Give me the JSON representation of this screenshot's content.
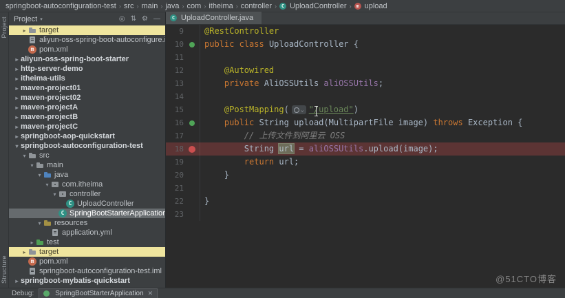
{
  "breadcrumb": {
    "separator": "›",
    "items": [
      {
        "label": "springboot-autoconfiguration-test"
      },
      {
        "label": "src"
      },
      {
        "label": "main"
      },
      {
        "label": "java"
      },
      {
        "label": "com"
      },
      {
        "label": "itheima"
      },
      {
        "label": "controller"
      },
      {
        "label": "UploadController",
        "icon": "class-icon"
      },
      {
        "label": "upload",
        "icon": "method-icon"
      }
    ]
  },
  "tool_strip": {
    "top": "Project",
    "bottom": "Structure"
  },
  "project_panel": {
    "title": "Project",
    "header_icons": [
      {
        "name": "locate-icon",
        "glyph": "◎"
      },
      {
        "name": "expand-collapse-icon",
        "glyph": "⇅"
      },
      {
        "name": "settings-gear-icon",
        "glyph": "⚙"
      },
      {
        "name": "hide-panel-icon",
        "glyph": "—"
      }
    ],
    "tree": [
      {
        "label": "target",
        "indent": 1,
        "chevron": "closed",
        "icon": "folder-icon",
        "highlight": "yellow"
      },
      {
        "label": "aliyun-oss-spring-boot-autoconfigure.iml",
        "indent": 1,
        "icon": "file-icon"
      },
      {
        "label": "pom.xml",
        "indent": 1,
        "icon": "maven-icon"
      },
      {
        "label": "aliyun-oss-spring-boot-starter",
        "indent": 0,
        "chevron": "closed",
        "bold": true
      },
      {
        "label": "http-server-demo",
        "indent": 0,
        "chevron": "closed",
        "bold": true
      },
      {
        "label": "itheima-utils",
        "indent": 0,
        "chevron": "closed",
        "bold": true
      },
      {
        "label": "maven-project01",
        "indent": 0,
        "chevron": "closed",
        "bold": true
      },
      {
        "label": "maven-project02",
        "indent": 0,
        "chevron": "closed",
        "bold": true
      },
      {
        "label": "maven-projectA",
        "indent": 0,
        "chevron": "closed",
        "bold": true
      },
      {
        "label": "maven-projectB",
        "indent": 0,
        "chevron": "closed",
        "bold": true
      },
      {
        "label": "maven-projectC",
        "indent": 0,
        "chevron": "closed",
        "bold": true
      },
      {
        "label": "springboot-aop-quickstart",
        "indent": 0,
        "chevron": "closed",
        "bold": true
      },
      {
        "label": "springboot-autoconfiguration-test",
        "indent": 0,
        "chevron": "open",
        "bold": true
      },
      {
        "label": "src",
        "indent": 1,
        "chevron": "open",
        "icon": "folder-icon"
      },
      {
        "label": "main",
        "indent": 2,
        "chevron": "open",
        "icon": "folder-icon"
      },
      {
        "label": "java",
        "indent": 3,
        "chevron": "open",
        "icon": "source-folder-icon"
      },
      {
        "label": "com.itheima",
        "indent": 4,
        "chevron": "open",
        "icon": "package-icon"
      },
      {
        "label": "controller",
        "indent": 5,
        "chevron": "open",
        "icon": "package-icon"
      },
      {
        "label": "UploadController",
        "indent": 6,
        "icon": "class-icon"
      },
      {
        "label": "SpringBootStarterApplication",
        "indent": 5,
        "icon": "class-icon",
        "selected": true
      },
      {
        "label": "resources",
        "indent": 3,
        "chevron": "open",
        "icon": "resources-folder-icon"
      },
      {
        "label": "application.yml",
        "indent": 4,
        "icon": "file-icon"
      },
      {
        "label": "test",
        "indent": 2,
        "chevron": "closed",
        "icon": "test-folder-icon"
      },
      {
        "label": "target",
        "indent": 1,
        "chevron": "closed",
        "icon": "folder-icon",
        "highlight": "yellow"
      },
      {
        "label": "pom.xml",
        "indent": 1,
        "icon": "maven-icon"
      },
      {
        "label": "springboot-autoconfiguration-test.iml",
        "indent": 1,
        "icon": "file-icon"
      },
      {
        "label": "springboot-mybatis-quickstart",
        "indent": 0,
        "chevron": "closed",
        "bold": true
      }
    ]
  },
  "editor": {
    "tab": {
      "label": "UploadController.java",
      "icon": "class-icon"
    },
    "lines": [
      {
        "num": 9,
        "segs": [
          [
            "@RestController",
            "ann"
          ]
        ]
      },
      {
        "num": 10,
        "gutter": "bean",
        "segs": [
          [
            "public ",
            "kw"
          ],
          [
            "class ",
            "kw"
          ],
          [
            "UploadController {",
            "def"
          ]
        ]
      },
      {
        "num": 11,
        "segs": []
      },
      {
        "num": 12,
        "segs": [
          [
            "    ",
            "def"
          ],
          [
            "@Autowired",
            "ann"
          ]
        ]
      },
      {
        "num": 13,
        "segs": [
          [
            "    ",
            "def"
          ],
          [
            "private ",
            "kw"
          ],
          [
            "AliOSSUtils ",
            "def"
          ],
          [
            "aliOSSUtils",
            "field"
          ],
          [
            ";",
            "def"
          ]
        ]
      },
      {
        "num": 14,
        "segs": []
      },
      {
        "num": 15,
        "segs": [
          [
            "    ",
            "def"
          ],
          [
            "@PostMapping",
            "ann"
          ],
          [
            "(",
            "def"
          ],
          [
            "",
            "inlay"
          ],
          [
            "\"/upload\"",
            "strU"
          ],
          [
            ")",
            "def"
          ]
        ]
      },
      {
        "num": 16,
        "gutter": "bean",
        "segs": [
          [
            "    ",
            "def"
          ],
          [
            "public ",
            "kw"
          ],
          [
            "String upload(MultipartFile image) ",
            "def"
          ],
          [
            "throws ",
            "kw"
          ],
          [
            "Exception {",
            "def"
          ]
        ]
      },
      {
        "num": 17,
        "segs": [
          [
            "        ",
            "def"
          ],
          [
            "// 上传文件到阿里云 OSS",
            "cmt"
          ]
        ]
      },
      {
        "num": 18,
        "gutter": "breakpoint",
        "line_style": "breakpoint",
        "segs": [
          [
            "        ",
            "def"
          ],
          [
            "String ",
            "def"
          ],
          [
            "url",
            "hl"
          ],
          [
            " = ",
            "def"
          ],
          [
            "aliOSSUtils",
            "field"
          ],
          [
            ".upload(image);",
            "def"
          ]
        ]
      },
      {
        "num": 19,
        "segs": [
          [
            "        ",
            "def"
          ],
          [
            "return ",
            "kw"
          ],
          [
            "url;",
            "def"
          ]
        ]
      },
      {
        "num": 20,
        "segs": [
          [
            "    }",
            "def"
          ]
        ]
      },
      {
        "num": 21,
        "segs": []
      },
      {
        "num": 22,
        "segs": [
          [
            "}",
            "def"
          ]
        ]
      },
      {
        "num": 23,
        "segs": []
      }
    ]
  },
  "debug_bar": {
    "label": "Debug:",
    "tab": {
      "icon": "spring-boot-icon",
      "label": "SpringBootStarterApplication",
      "close": "✕"
    }
  },
  "watermark": "@51CTO博客",
  "colors": {
    "panel_bg": "#3c3f41",
    "editor_bg": "#2b2b2b",
    "annotation": "#bbb529",
    "keyword": "#cc7832",
    "string": "#6a8759",
    "comment": "#808080",
    "field": "#9876aa",
    "default_text": "#a9b7c6",
    "breakpoint_line": "#5c3434",
    "breakpoint_dot": "#cb4f4f",
    "bean_marker": "#4fa457",
    "selection_row": "#666b6e",
    "yellow_highlight": "#efe59e"
  }
}
